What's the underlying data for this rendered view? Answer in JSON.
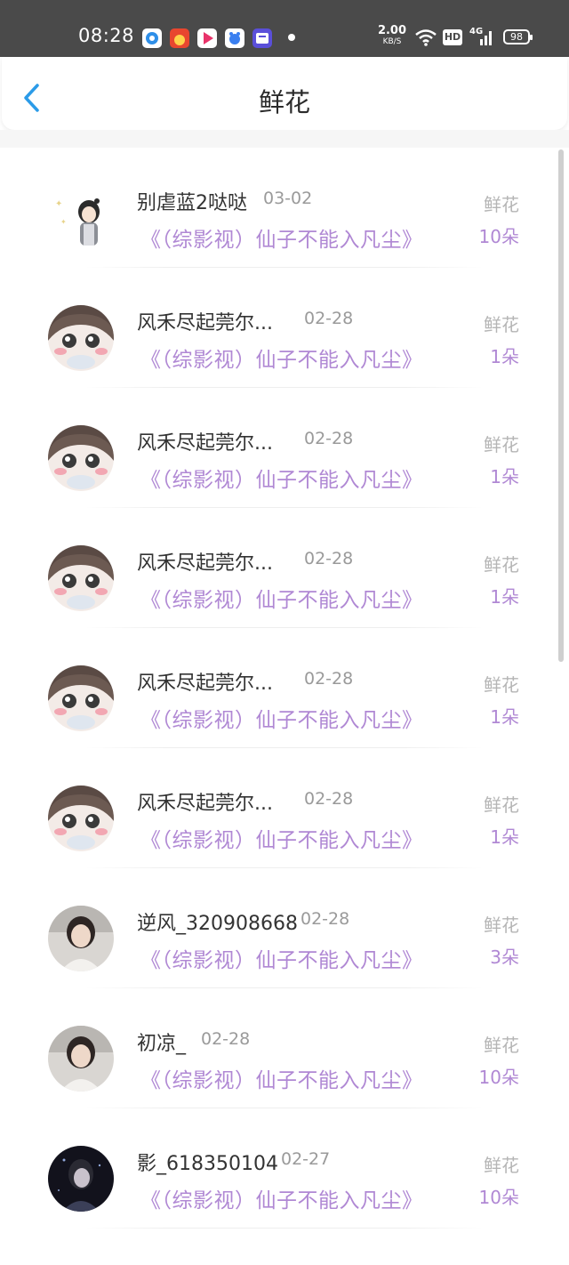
{
  "status_bar": {
    "time": "08:28",
    "net_speed_value": "2.00",
    "net_speed_unit": "KB/S",
    "hd_badge": "HD",
    "network": "4G",
    "battery": "98"
  },
  "header": {
    "title": "鲜花",
    "back_icon": "chevron-left-icon"
  },
  "list": {
    "gift_label": "鲜花",
    "items": [
      {
        "user": "别虐蓝2哒哒",
        "date": "03-02",
        "book": "《（综影视）仙子不能入凡尘》",
        "count": "10朵",
        "avatar": "anime-avatar"
      },
      {
        "user": "风禾尽起莞尔...",
        "date": "02-28",
        "book": "《（综影视）仙子不能入凡尘》",
        "count": "1朵",
        "avatar": "cute-girl-avatar"
      },
      {
        "user": "风禾尽起莞尔...",
        "date": "02-28",
        "book": "《（综影视）仙子不能入凡尘》",
        "count": "1朵",
        "avatar": "cute-girl-avatar"
      },
      {
        "user": "风禾尽起莞尔...",
        "date": "02-28",
        "book": "《（综影视）仙子不能入凡尘》",
        "count": "1朵",
        "avatar": "cute-girl-avatar"
      },
      {
        "user": "风禾尽起莞尔...",
        "date": "02-28",
        "book": "《（综影视）仙子不能入凡尘》",
        "count": "1朵",
        "avatar": "cute-girl-avatar"
      },
      {
        "user": "风禾尽起莞尔...",
        "date": "02-28",
        "book": "《（综影视）仙子不能入凡尘》",
        "count": "1朵",
        "avatar": "cute-girl-avatar"
      },
      {
        "user": "逆风_320908668",
        "date": "02-28",
        "book": "《（综影视）仙子不能入凡尘》",
        "count": "3朵",
        "avatar": "photo-avatar"
      },
      {
        "user": "初凉_",
        "date": "02-28",
        "book": "《（综影视）仙子不能入凡尘》",
        "count": "10朵",
        "avatar": "photo-avatar"
      },
      {
        "user": "影_618350104",
        "date": "02-27",
        "book": "《（综影视）仙子不能入凡尘》",
        "count": "10朵",
        "avatar": "dark-photo-avatar"
      }
    ]
  },
  "colors": {
    "accent_purple": "#b088d4",
    "back_blue": "#2b9be8",
    "status_bar_bg": "#4a4a4a"
  }
}
